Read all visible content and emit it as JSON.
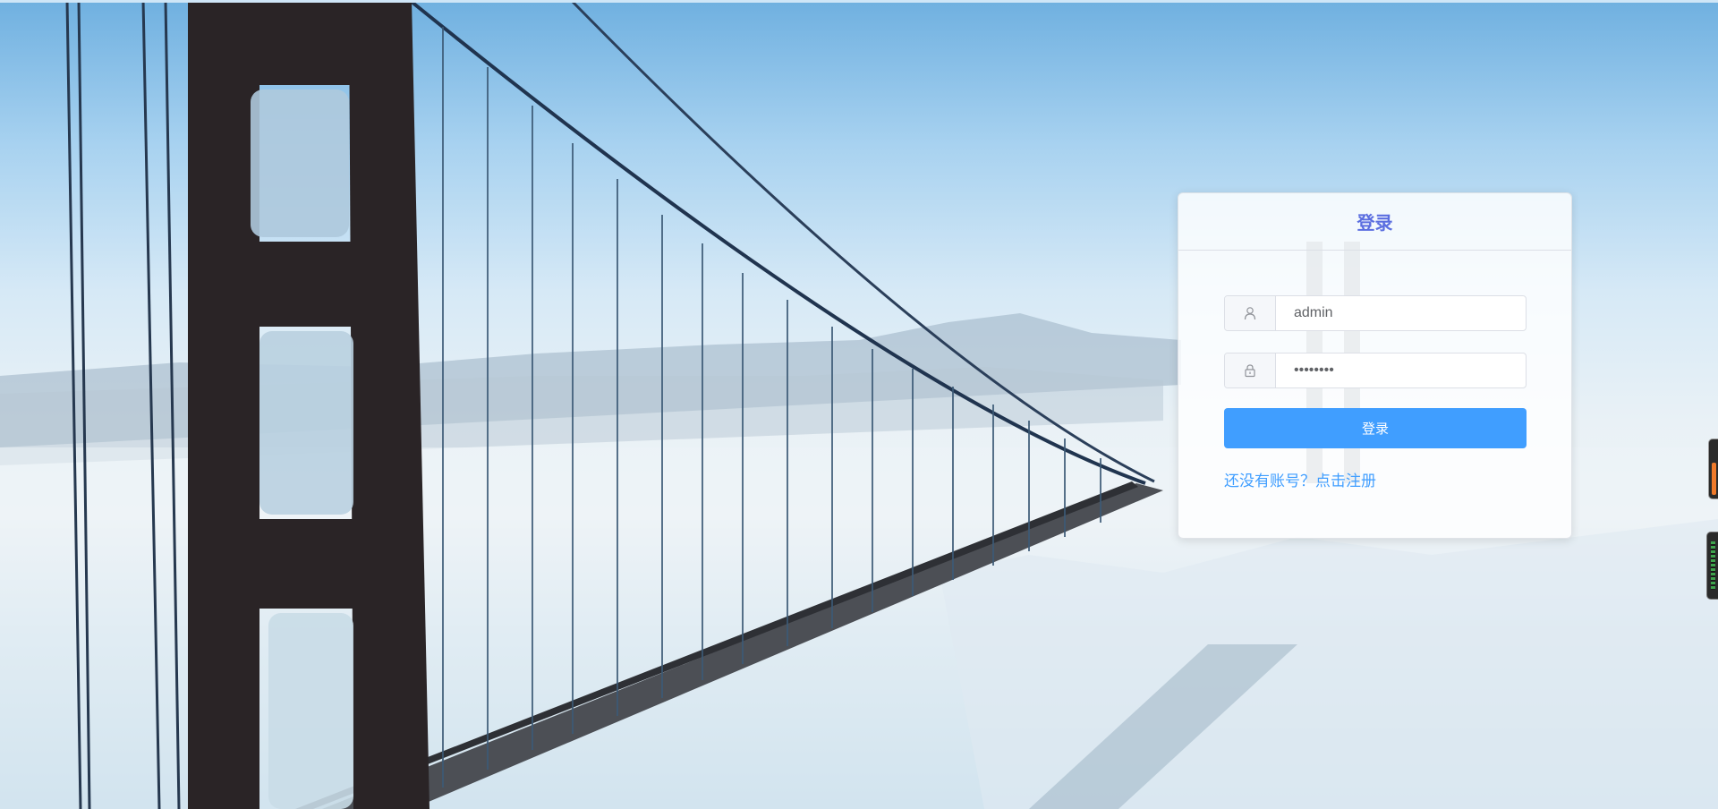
{
  "login": {
    "title": "登录",
    "username_value": "admin",
    "password_value": "••••••••",
    "submit_label": "登录",
    "register_link": "还没有账号？点击注册"
  },
  "icons": {
    "username": "user-icon",
    "password": "lock-icon"
  },
  "colors": {
    "title": "#5b6ee0",
    "button": "#409eff",
    "link": "#409eff"
  }
}
